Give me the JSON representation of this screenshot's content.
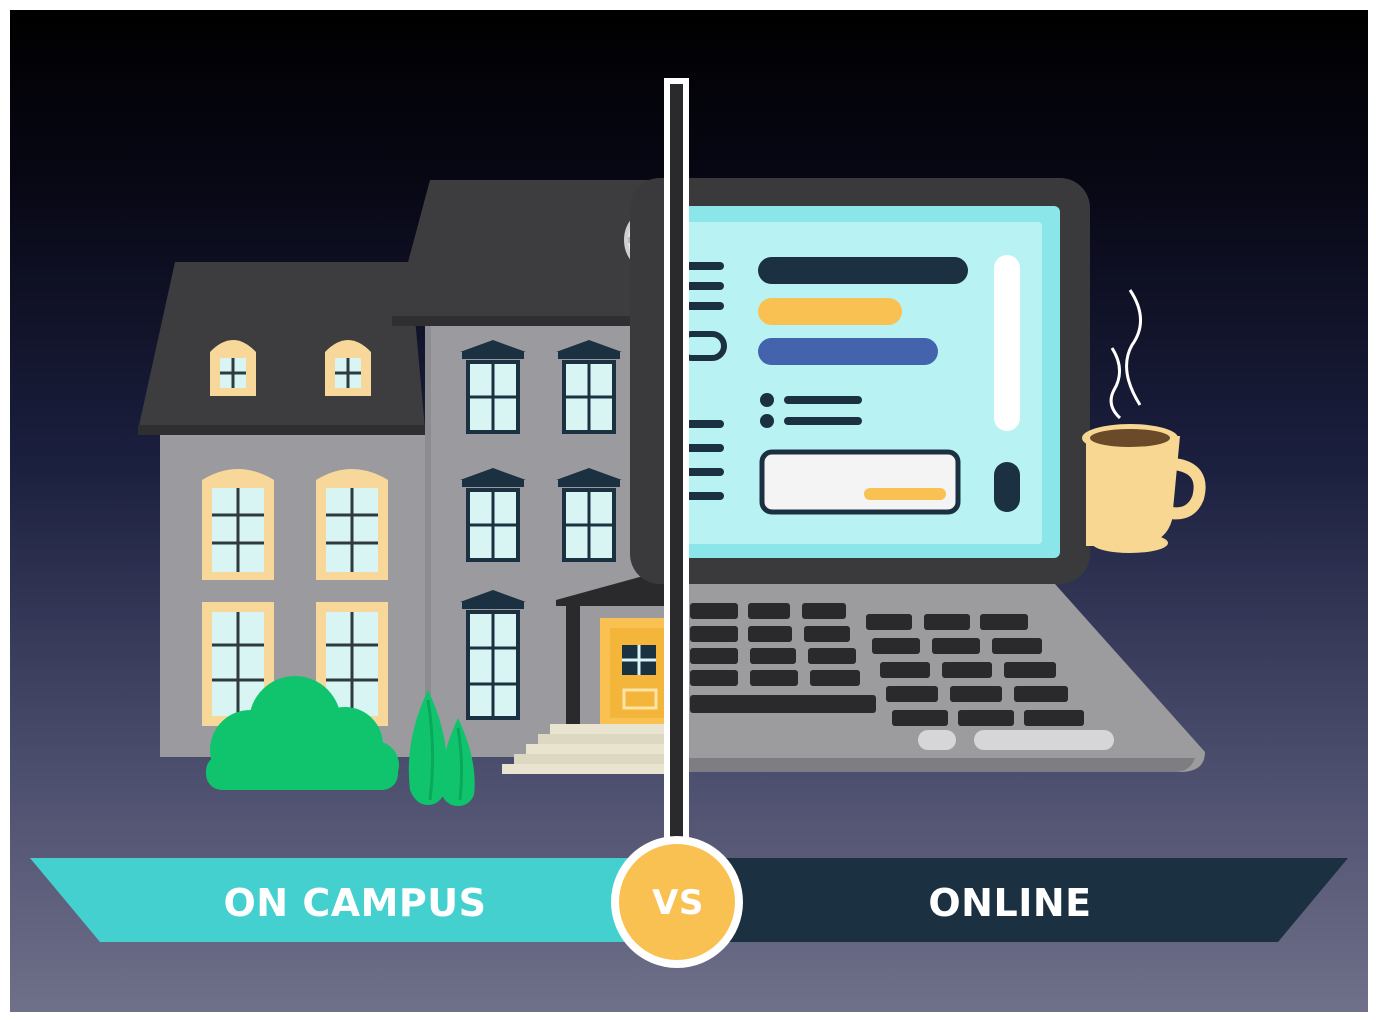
{
  "comparison": {
    "left_label": "ON CAMPUS",
    "right_label": "ONLINE",
    "divider_label": "VS"
  },
  "colors": {
    "left_banner": "#45d0d0",
    "right_banner": "#1b3040",
    "vs_badge": "#f9c152",
    "building_wall": "#9b9b9f",
    "roof": "#3d3d3f",
    "window_frame": "#f7d79a",
    "window_glass": "#d8f5f3",
    "bush": "#0fc46d",
    "screen": "#b8f2f2",
    "laptop_body": "#3a3a3c",
    "keyboard_deck": "#9c9c9e",
    "coffee_cup": "#f7d791"
  },
  "icons": [
    "building-illustration",
    "laptop-illustration",
    "coffee-cup-icon",
    "bush-icon",
    "tree-icon"
  ]
}
